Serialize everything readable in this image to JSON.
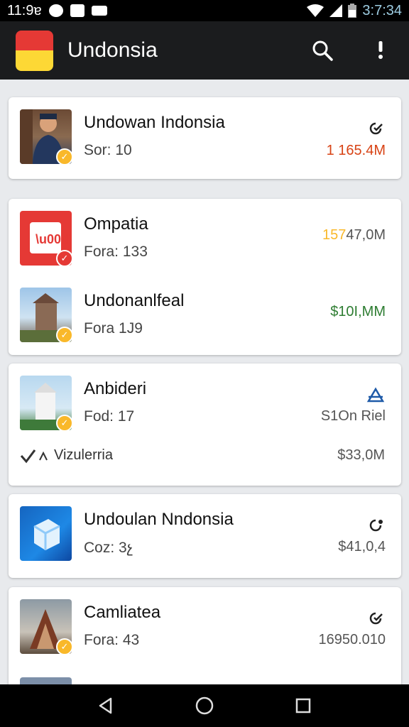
{
  "status_bar": {
    "time_left": "11:9ɐ",
    "time_right": "3:7:34"
  },
  "app_bar": {
    "title": "Undonsia"
  },
  "list": {
    "item1": {
      "title": "Undowan Indonsia",
      "sub": "Sor: 10",
      "value": "1 165.4M",
      "value_color": "#d84315"
    },
    "item2": {
      "title": "Ompatia",
      "sub": "Fora: 133",
      "value_a": "157",
      "value_b": "47,0M"
    },
    "item3": {
      "title": "Undonanlfeal",
      "sub": "Fora 1J9",
      "value": "$10І,MM",
      "value_color": "#2e7d32"
    },
    "item4": {
      "title": "Anbideri",
      "sub": "Fod: 17",
      "value": "S1On Riel",
      "extra_label": "Vizulerria",
      "extra_value": "$33,0M"
    },
    "item5": {
      "title": "Undoulan Nndonsia",
      "sub": "Coz: 3չ",
      "value": "$41,0,4"
    },
    "item6": {
      "title": "Camliatea",
      "sub": "Fora: 43",
      "value": "16950.010"
    }
  },
  "colors": {
    "accent_orange": "#f9b82a",
    "accent_red": "#e53935",
    "green": "#2e7d32"
  }
}
